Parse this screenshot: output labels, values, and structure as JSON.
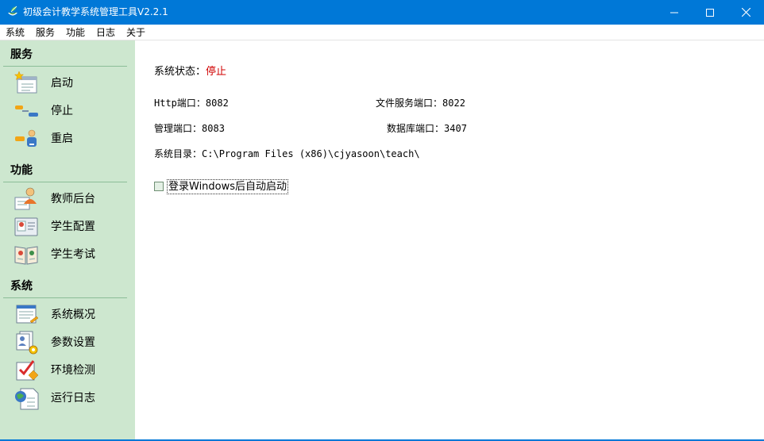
{
  "window": {
    "title": "初级会计教学系统管理工具V2.2.1",
    "controls": {
      "minimize": "minimize",
      "maximize": "maximize",
      "close": "close"
    }
  },
  "menu": {
    "items": [
      {
        "label": "系统"
      },
      {
        "label": "服务"
      },
      {
        "label": "功能"
      },
      {
        "label": "日志"
      },
      {
        "label": "关于"
      }
    ]
  },
  "sidebar": {
    "groups": [
      {
        "title": "服务",
        "items": [
          {
            "label": "启动",
            "icon": "start-service-icon"
          },
          {
            "label": "停止",
            "icon": "stop-service-icon"
          },
          {
            "label": "重启",
            "icon": "restart-service-icon"
          }
        ]
      },
      {
        "title": "功能",
        "items": [
          {
            "label": "教师后台",
            "icon": "teacher-icon"
          },
          {
            "label": "学生配置",
            "icon": "student-config-icon"
          },
          {
            "label": "学生考试",
            "icon": "student-exam-icon"
          }
        ]
      },
      {
        "title": "系统",
        "items": [
          {
            "label": "系统概况",
            "icon": "system-overview-icon"
          },
          {
            "label": "参数设置",
            "icon": "settings-icon"
          },
          {
            "label": "环境检测",
            "icon": "environment-check-icon"
          },
          {
            "label": "运行日志",
            "icon": "run-log-icon"
          }
        ]
      }
    ]
  },
  "main": {
    "status_label": "系统状态：",
    "status_value": "停止",
    "status_color": "#d00000",
    "http_port_label": "Http端口：",
    "http_port": "8082",
    "file_port_label": "文件服务端口：",
    "file_port": "8022",
    "admin_port_label": "管理端口：",
    "admin_port": "8083",
    "db_port_label": "数据库端口：",
    "db_port": "3407",
    "dir_label": "系统目录：",
    "dir_value": "C:\\Program Files (x86)\\cjyasoon\\teach\\",
    "autostart_label": "登录Windows后自动启动",
    "autostart_checked": false
  },
  "colors": {
    "titlebar": "#0078d7",
    "sidebar": "#cde7cf",
    "group_line": "#8bbd98"
  }
}
